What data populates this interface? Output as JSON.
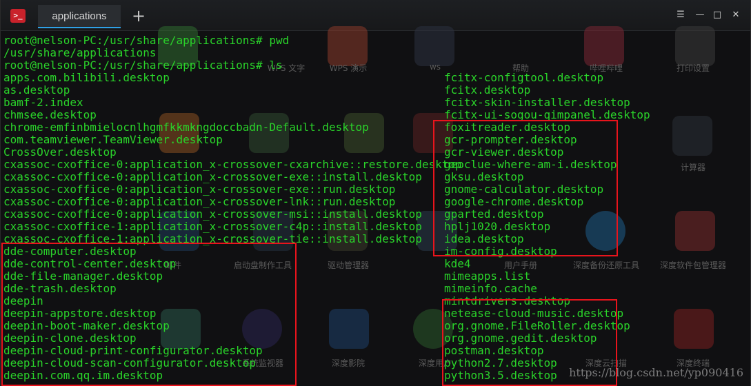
{
  "titlebar": {
    "app_icon": ">_",
    "tab_label": "applications",
    "new_tab": "+",
    "menu": "☰",
    "minimize": "—",
    "maximize": "□",
    "close": "✕"
  },
  "desktop_labels": [
    "WPS 文字",
    "WPS 演示",
    "ws",
    "帮助",
    "哔哩哔哩",
    "打印设置",
    "计算器",
    "邮件",
    "启动盘制作工具",
    "驱动管理器",
    "用户手册",
    "深度备份还原工具",
    "深度软件包管理器",
    "系统监视器",
    "深度影院",
    "深度用户",
    "深度云扫描",
    "深度终端"
  ],
  "terminal": {
    "left_lines": [
      "root@nelson-PC:/usr/share/applications# pwd",
      "/usr/share/applications",
      "root@nelson-PC:/usr/share/applications# ls",
      "apps.com.bilibili.desktop",
      "as.desktop",
      "bamf-2.index",
      "chmsee.desktop",
      "chrome-emfinbmielocnlhgmfkkmkngdoccbadn-Default.desktop",
      "com.teamviewer.TeamViewer.desktop",
      "CrossOver.desktop",
      "cxassoc-cxoffice-0:application_x-crossover-cxarchive::restore.desktop",
      "cxassoc-cxoffice-0:application_x-crossover-exe::install.desktop",
      "cxassoc-cxoffice-0:application_x-crossover-exe::run.desktop",
      "cxassoc-cxoffice-0:application_x-crossover-lnk::run.desktop",
      "cxassoc-cxoffice-0:application_x-crossover-msi::install.desktop",
      "cxassoc-cxoffice-1:application_x-crossover-c4p::install.desktop",
      "cxassoc-cxoffice-1:application_x-crossover-tie::install.desktop",
      "dde-computer.desktop",
      "dde-control-center.desktop",
      "dde-file-manager.desktop",
      "dde-trash.desktop",
      "deepin",
      "deepin-appstore.desktop",
      "deepin-boot-maker.desktop",
      "deepin-clone.desktop",
      "deepin-cloud-print-configurator.desktop",
      "deepin-cloud-scan-configurator.desktop",
      "deepin.com.qq.im.desktop"
    ],
    "right_lines": [
      "fcitx-configtool.desktop",
      "fcitx.desktop",
      "fcitx-skin-installer.desktop",
      "fcitx-ui-sogou-qimpanel.desktop",
      "foxitreader.desktop",
      "gcr-prompter.desktop",
      "gcr-viewer.desktop",
      "geoclue-where-am-i.desktop",
      "gksu.desktop",
      "gnome-calculator.desktop",
      "google-chrome.desktop",
      "gparted.desktop",
      "hplj1020.desktop",
      "idea.desktop",
      "im-config.desktop",
      "kde4",
      "mimeapps.list",
      "mimeinfo.cache",
      "mintdrivers.desktop",
      "netease-cloud-music.desktop",
      "org.gnome.FileRoller.desktop",
      "org.gnome.gedit.desktop",
      "postman.desktop",
      "python2.7.desktop",
      "python3.5.desktop"
    ]
  },
  "watermark": "https://blog.csdn.net/yp090416",
  "colors": {
    "terminal_text": "#2ad42a",
    "highlight_box": "#e8141c",
    "tab_accent": "#2ea1e6"
  }
}
